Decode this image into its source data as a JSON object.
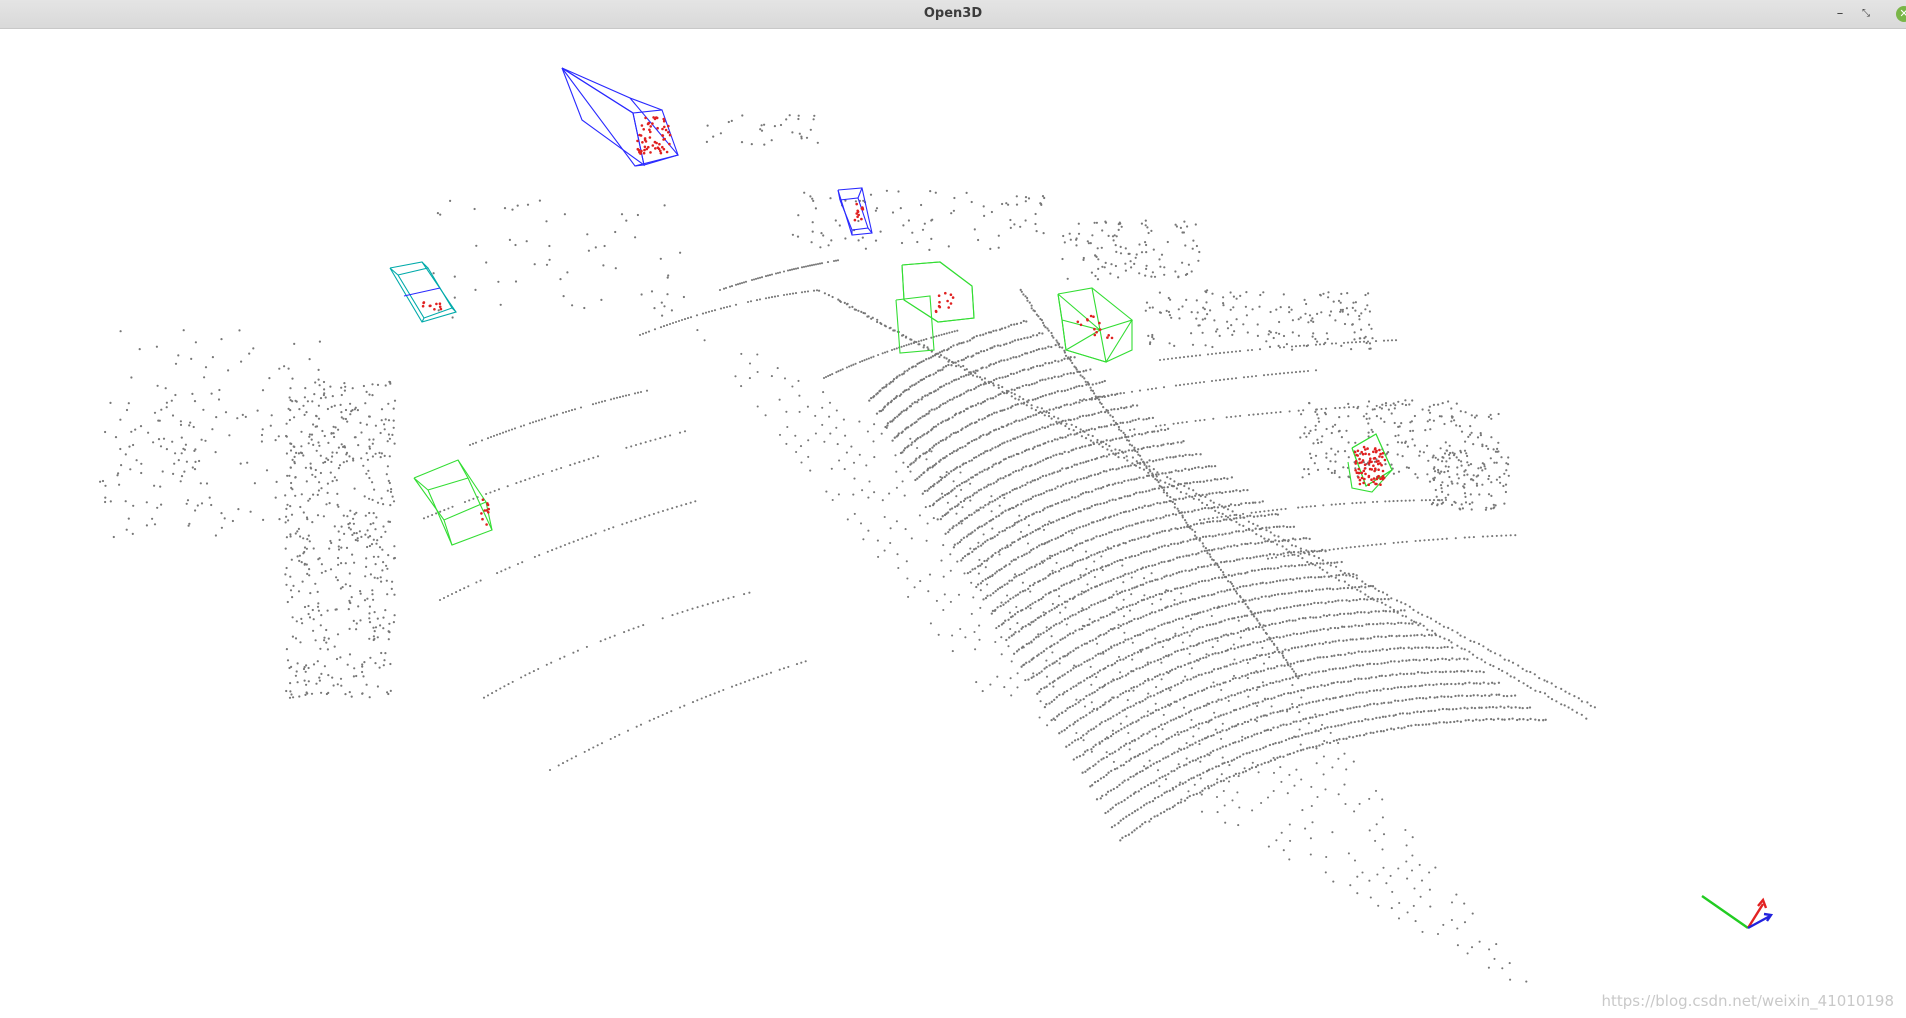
{
  "window": {
    "title": "Open3D",
    "controls": {
      "minimize_icon": "minimize-icon",
      "maximize_icon": "restore-icon",
      "close_icon": "close-icon"
    }
  },
  "viewer": {
    "point_color": "#777777",
    "box_colors": {
      "blue": "#2a2aff",
      "green": "#33dd33",
      "cyan": "#00aaaa"
    },
    "inlier_color": "#e02020",
    "axes": {
      "x_color": "#e22222",
      "y_color": "#22cc22",
      "z_color": "#2222dd"
    }
  },
  "watermark": {
    "text": "https://blog.csdn.net/weixin_41010198"
  }
}
